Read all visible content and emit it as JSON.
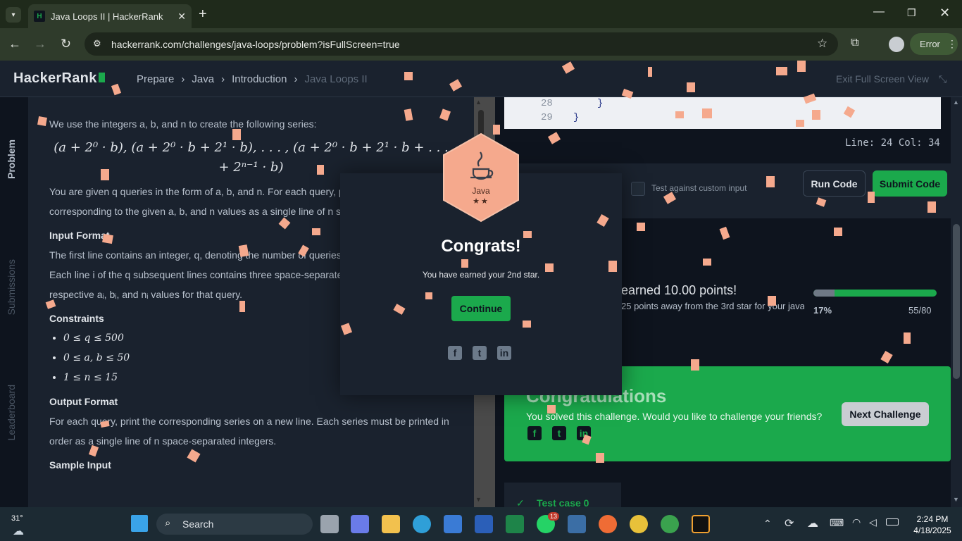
{
  "browser": {
    "tab_title": "Java Loops II | HackerRank",
    "favicon_text": "H",
    "url": "hackerrank.com/challenges/java-loops/problem?isFullScreen=true",
    "profile_status": "Error"
  },
  "site": {
    "logo": "HackerRank",
    "breadcrumbs": [
      "Prepare",
      "Java",
      "Introduction",
      "Java Loops II"
    ],
    "exit_fullscreen": "Exit Full Screen View"
  },
  "side_tabs": [
    "Problem",
    "Submissions",
    "Leaderboard"
  ],
  "problem": {
    "intro": "We use the integers a, b, and n to create the following series:",
    "series_formula": "(a + 2⁰ · b), (a + 2⁰ · b + 2¹ · b), . . . , (a + 2⁰ · b + 2¹ · b + . . . + 2ⁿ⁻¹ · b)",
    "queries_text_1": "You are given q queries in the form of a, b, and n. For each query, p",
    "queries_text_2": "corresponding to the given a, b, and n values as a single line of n sp",
    "input_format_heading": "Input Format",
    "input_line_1": "The first line contains an integer, q, denoting the number of queries.",
    "input_line_2": "Each line i of the q subsequent lines contains three space-separated",
    "input_line_3": "respective aᵢ, bᵢ, and nᵢ values for that query.",
    "constraints_heading": "Constraints",
    "constraints": [
      "0 ≤ q ≤ 500",
      "0 ≤ a, b ≤ 50",
      "1 ≤ n ≤ 15"
    ],
    "output_format_heading": "Output Format",
    "output_line_1": "For each query, print the corresponding series on a new line. Each series must be printed in",
    "output_line_2": "order as a single line of n space-separated integers.",
    "sample_input_heading": "Sample Input"
  },
  "editor": {
    "line_numbers": [
      "28",
      "29"
    ],
    "code_lines": [
      "}",
      "}"
    ],
    "cursor_info": "Line: 24 Col: 34"
  },
  "run": {
    "custom_input_label": "Test against custom input",
    "run_label": "Run Code",
    "submit_label": "Submit Code"
  },
  "progress": {
    "earned_text": "earned 10.00 points!",
    "away_text": "25 points away from the 3rd star for your java",
    "percent_label": "17%",
    "percent_value": 0.17,
    "points_label": "55/80"
  },
  "result_panel": {
    "title": "Congratulations",
    "subtitle": "You solved this challenge. Would you like to challenge your friends?",
    "next_label": "Next Challenge",
    "share_icons": [
      "facebook-icon",
      "twitter-icon",
      "linkedin-icon"
    ]
  },
  "test_case": "Test case 0",
  "modal": {
    "badge_label": "Java",
    "badge_stars": "★★",
    "title": "Congrats!",
    "subtitle": "You have earned your 2nd star.",
    "continue_label": "Continue",
    "share_icons": [
      "facebook-icon",
      "twitter-icon",
      "linkedin-icon"
    ]
  },
  "taskbar": {
    "weather_temp": "31°",
    "search_placeholder": "Search",
    "time": "2:24 PM",
    "date": "4/18/2025",
    "notification_badge": "13"
  },
  "colors": {
    "accent_green": "#1ba94c",
    "confetti": "#f5a98d",
    "badge": "#f5a98d",
    "panel_dark": "#1a222e"
  }
}
